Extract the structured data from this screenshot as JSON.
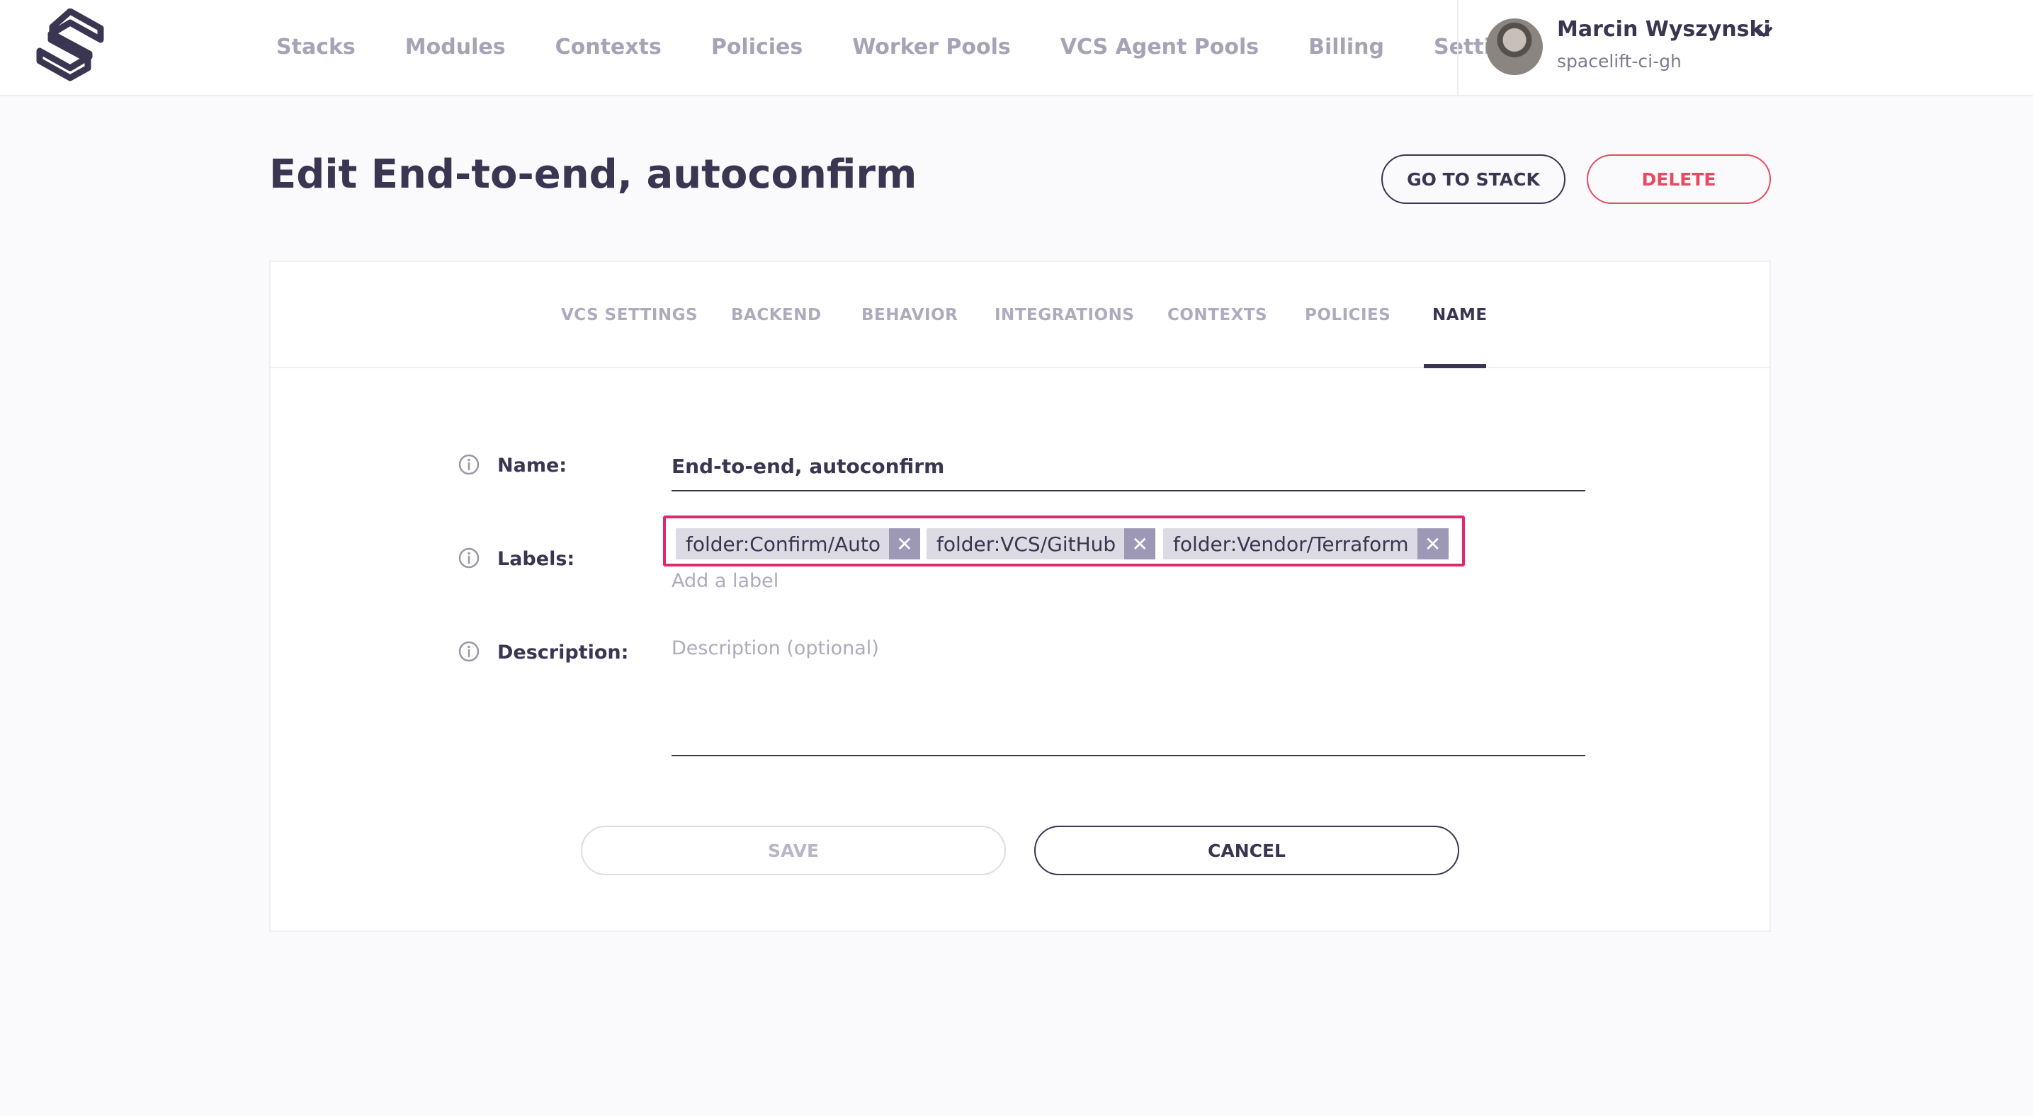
{
  "nav": {
    "items": [
      "Stacks",
      "Modules",
      "Contexts",
      "Policies",
      "Worker Pools",
      "VCS Agent Pools",
      "Billing",
      "Settings"
    ]
  },
  "user": {
    "name": "Marcin Wyszynski",
    "org": "spacelift-ci-gh"
  },
  "header": {
    "title": "Edit End-to-end, autoconfirm",
    "go_to_stack_label": "GO TO STACK",
    "delete_label": "DELETE"
  },
  "tabs": [
    {
      "label": "VCS SETTINGS",
      "active": false
    },
    {
      "label": "BACKEND",
      "active": false
    },
    {
      "label": "BEHAVIOR",
      "active": false
    },
    {
      "label": "INTEGRATIONS",
      "active": false
    },
    {
      "label": "CONTEXTS",
      "active": false
    },
    {
      "label": "POLICIES",
      "active": false
    },
    {
      "label": "NAME",
      "active": true
    }
  ],
  "form": {
    "name_label": "Name:",
    "name_value": "End-to-end, autoconfirm",
    "labels_label": "Labels:",
    "labels": [
      "folder:Confirm/Auto",
      "folder:VCS/GitHub",
      "folder:Vendor/Terraform"
    ],
    "add_label_placeholder": "Add a label",
    "description_label": "Description:",
    "description_placeholder": "Description (optional)",
    "description_value": "",
    "save_label": "SAVE",
    "cancel_label": "CANCEL"
  },
  "icons": {
    "logo": "spacelift-logo",
    "user_menu": "chevron-down-icon",
    "field_info": "info-icon",
    "chip_remove": "close-icon"
  },
  "colors": {
    "primary": "#3a3550",
    "danger": "#e84a5f",
    "highlight": "#e3266d",
    "chip_bg": "#dcdae3",
    "chip_close_bg": "#9d98b6"
  }
}
